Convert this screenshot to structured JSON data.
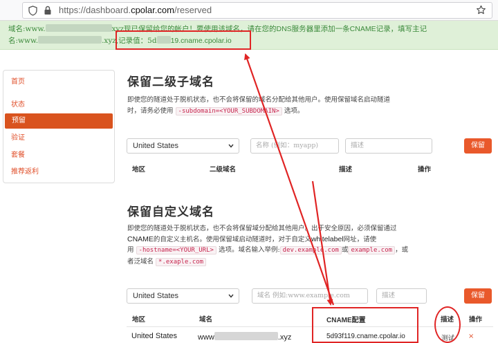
{
  "browser": {
    "url_prefix": "https://dashboard.",
    "url_domain": "cpolar.com",
    "url_path": "/reserved"
  },
  "alert": {
    "line1_a": "域名:www.",
    "line1_b": "xyz现已保留给您的帐户！要使用该域名，请在您的",
    "line1_c": "DNS",
    "line1_d": "服务器里添加一条",
    "line1_e": "CNAME",
    "line1_f": "记录，填写主记",
    "line2_a": "名:www.",
    "line2_b": ".xyz,记录值：5d",
    "line2_c": "19.cname.cpolar.io"
  },
  "sidebar": {
    "items": [
      {
        "label": "首页"
      },
      {
        "label": "状态"
      },
      {
        "label": "预留"
      },
      {
        "label": "验证"
      },
      {
        "label": "套餐"
      },
      {
        "label": "推荐返利"
      }
    ]
  },
  "subdomain": {
    "title": "保留二级子域名",
    "desc1": "即使您的隧道处于脱机状态，也不会将保留的域名分配给其他用户。使用保留域名启动隧道",
    "desc2_a": "时，请务必使用",
    "desc2_code": "-subdomain=<YOUR_SUBDOMAIN>",
    "desc2_b": "选项。",
    "region_value": "United States",
    "name_placeholder": "名称 (例如：myapp)",
    "desc_placeholder": "描述",
    "reserve_button": "保留",
    "columns": [
      "地区",
      "二级域名",
      "描述",
      "操作"
    ]
  },
  "custom": {
    "title": "保留自定义域名",
    "desc1": "即使您的隧道处于脱机状态，也不会将保留域分配给其他用户。出于安全原因，必须保留通过",
    "desc2_a": "CNAME",
    "desc2_b": "的自定义主机名。使用保留域启动隧道时，对于自定义",
    "desc2_c": "whitelabel",
    "desc2_d": "网址，请使",
    "desc3_a": "用",
    "desc3_code": "-hostname=<YOUR_URL>",
    "desc3_b": "选项。域名输入举例:",
    "desc3_code2": "dev.example.com",
    "desc3_c": "或",
    "desc3_code3": "example.com",
    "desc3_d": "，或",
    "desc4_a": "者泛域名",
    "desc4_code": "*.exaple.com",
    "region_value": "United States",
    "domain_placeholder": "域名 例如:www.example.com",
    "desc_placeholder": "描述",
    "reserve_button": "保留",
    "columns": [
      "地区",
      "域名",
      "CNAME配置",
      "描述",
      "操作"
    ],
    "row": {
      "region": "United States",
      "domain_a": "www",
      "domain_b": ".xyz",
      "cname": "5d93f119.cname.cpolar.io",
      "desc": "测试",
      "delete": "×"
    }
  },
  "colors": {
    "accent": "#e9592b",
    "alert_bg": "#dff0d8",
    "alert_text": "#3c8a3c",
    "annotation": "#e02424"
  }
}
